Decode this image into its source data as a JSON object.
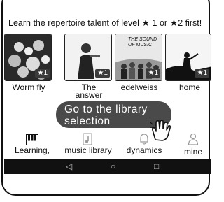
{
  "header": {
    "text_before": "Learn the repertoire talent of level ",
    "star": "★",
    "level_1": "1",
    "or_text": " or ",
    "level_2": "2 first!"
  },
  "cards": [
    {
      "title": "Worm fly",
      "badge_star": "★",
      "badge_level": "1"
    },
    {
      "title_line1": "The",
      "title_line2": "answer",
      "badge_star": "★",
      "badge_level": "1"
    },
    {
      "title": "edelweiss",
      "badge_star": "★",
      "badge_level": "1",
      "thumb_text_1": "THE SOUND",
      "thumb_text_2": "OF MUSIC"
    },
    {
      "title": "home",
      "badge_star": "★",
      "badge_level": "1"
    }
  ],
  "callout": {
    "line1": "Go to the library",
    "line2": "selection"
  },
  "tabs": [
    {
      "label": "Learning,",
      "icon": "piano-icon"
    },
    {
      "label": "music library",
      "icon": "music-note-icon"
    },
    {
      "label": "dynamics",
      "icon": "bell-icon"
    },
    {
      "label": "mine",
      "icon": "person-icon"
    }
  ],
  "navbar": {
    "back": "◁",
    "home": "○",
    "recent": "□"
  },
  "colors": {
    "callout_bg": "#4a4a4a",
    "navbar_bg": "#111111"
  }
}
